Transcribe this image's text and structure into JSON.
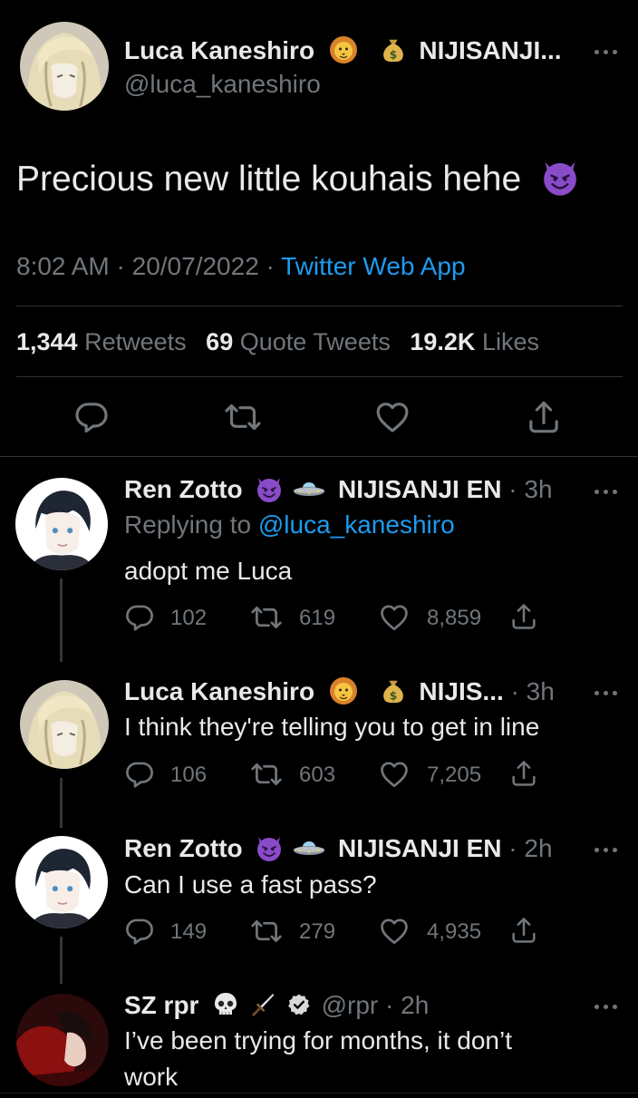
{
  "main_tweet": {
    "author_name": "Luca Kaneshiro",
    "affiliation": "NIJISANJI...",
    "handle": "@luca_kaneshiro",
    "text": "Precious new little kouhais hehe",
    "time": "8:02 AM",
    "date": "20/07/2022",
    "source": "Twitter Web App",
    "retweets_count": "1,344",
    "retweets_label": "Retweets",
    "quotes_count": "69",
    "quotes_label": "Quote Tweets",
    "likes_count": "19.2K",
    "likes_label": "Likes"
  },
  "replies": [
    {
      "author_name": "Ren Zotto",
      "affiliation": "NIJISANJI EN",
      "time": "3h",
      "replying_prefix": "Replying to",
      "replying_handle": "@luca_kaneshiro",
      "text": "adopt me Luca",
      "replies": "102",
      "retweets": "619",
      "likes": "8,859"
    },
    {
      "author_name": "Luca Kaneshiro",
      "affiliation": "NIJIS...",
      "time": "3h",
      "text": "I think they're telling you to get in line",
      "replies": "106",
      "retweets": "603",
      "likes": "7,205"
    },
    {
      "author_name": "Ren Zotto",
      "affiliation": "NIJISANJI EN",
      "time": "2h",
      "text": "Can I use a fast pass?",
      "replies": "149",
      "retweets": "279",
      "likes": "4,935"
    },
    {
      "author_name": "SZ rpr",
      "handle": "@rpr",
      "time": "2h",
      "text_line1": "I’ve been trying for months, it don’t",
      "text_line2": "work"
    }
  ],
  "icons": {
    "reply": "reply-icon",
    "retweet": "retweet-icon",
    "like": "heart-icon",
    "share": "share-icon",
    "more": "more-icon"
  },
  "colors": {
    "background": "#000000",
    "text": "#e7e9ea",
    "secondary": "#71767b",
    "link": "#1d9bf0"
  }
}
